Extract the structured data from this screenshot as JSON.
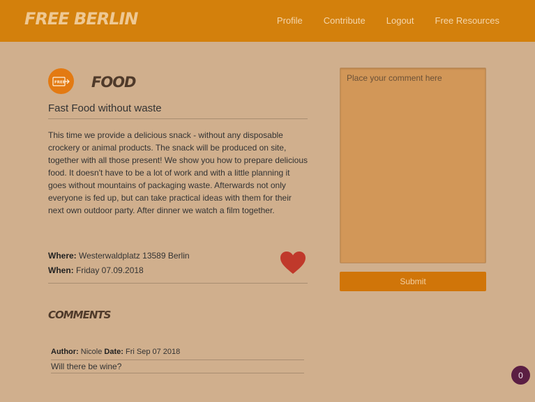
{
  "nav": {
    "brand": "FREE BERLIN",
    "links": [
      "Profile",
      "Contribute",
      "Logout",
      "Free Resources"
    ]
  },
  "category": {
    "icon": "free-ticket-icon",
    "badge_text": "FREE",
    "title": "FOOD"
  },
  "event": {
    "title": "Fast Food without waste",
    "description": "This time we provide a delicious snack - without any disposable crockery or animal products. The snack will be produced on site, together with all those present! We show you how to prepare delicious food. It doesn't have to be a lot of work and with a little planning it goes without mountains of packaging waste. Afterwards not only everyone is fed up, but can take practical ideas with them for their next own outdoor party. After dinner we watch a film together.",
    "where_label": "Where:",
    "where": "Westerwaldplatz 13589 Berlin",
    "when_label": "When:",
    "when": "Friday 07.09.2018",
    "like_icon": "heart-icon"
  },
  "comments": {
    "title": "COMMENTS",
    "items": [
      {
        "author_label": "Author:",
        "author": "Nicole",
        "date_label": "Date:",
        "date": "Fri Sep 07 2018",
        "text": "Will there be wine?"
      }
    ]
  },
  "comment_form": {
    "placeholder": "Place your comment here",
    "submit_label": "Submit"
  },
  "counter": "0",
  "colors": {
    "background": "#d0af8d",
    "navbar": "#d3800c",
    "accent": "#d07509",
    "heart": "#c0392b",
    "counter_bg": "#5b1e43"
  }
}
